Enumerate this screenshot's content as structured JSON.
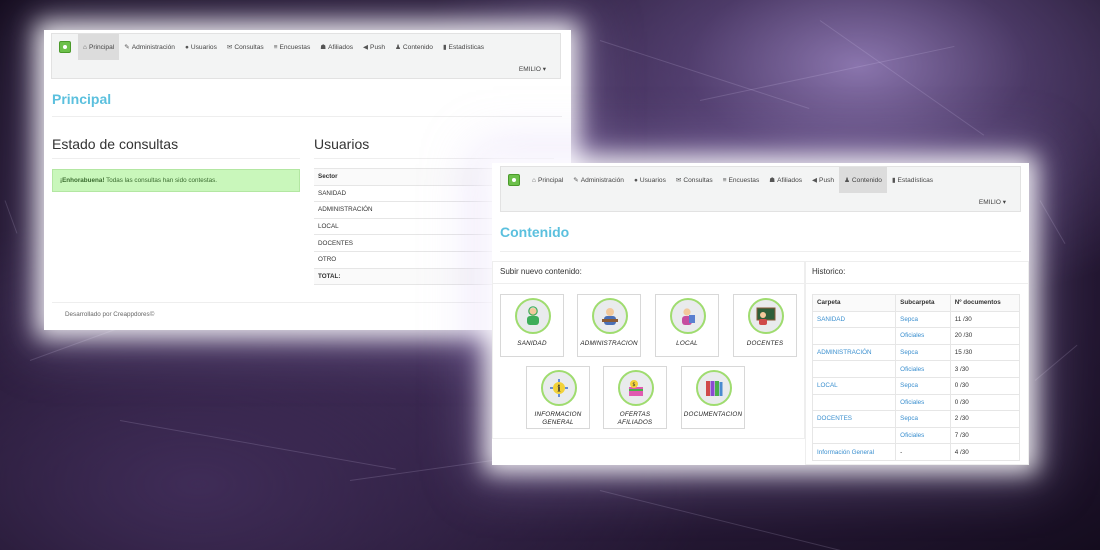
{
  "nav": {
    "items": [
      {
        "icon": "home-icon",
        "glyph": "⌂",
        "label": "Principal"
      },
      {
        "icon": "wrench-icon",
        "glyph": "✎",
        "label": "Administración"
      },
      {
        "icon": "user-icon",
        "glyph": "●",
        "label": "Usuarios"
      },
      {
        "icon": "envelope-icon",
        "glyph": "✉",
        "label": "Consultas"
      },
      {
        "icon": "list-icon",
        "glyph": "≡",
        "label": "Encuestas"
      },
      {
        "icon": "group-icon",
        "glyph": "☗",
        "label": "Afiliados"
      },
      {
        "icon": "megaphone-icon",
        "glyph": "◀",
        "label": "Push"
      },
      {
        "icon": "content-icon",
        "glyph": "♟",
        "label": "Contenido"
      },
      {
        "icon": "stats-icon",
        "glyph": "▮",
        "label": "Estadísticas"
      }
    ],
    "user": "EMILIO ▾"
  },
  "window1": {
    "active": "Principal",
    "title": "Principal",
    "consultas_heading": "Estado de consultas",
    "alert_strong": "¡Enhorabuena!",
    "alert_text": " Todas las consultas han sido contestas.",
    "usuarios_heading": "Usuarios",
    "sector_header": "Sector",
    "sectors": [
      "SANIDAD",
      "ADMINISTRACIÓN",
      "LOCAL",
      "DOCENTES",
      "OTRO"
    ],
    "total_label": "TOTAL:",
    "footer": "Desarrollado por Creappdores©"
  },
  "window2": {
    "active": "Contenido",
    "title": "Contenido",
    "upload_heading": "Subir nuevo contenido:",
    "tiles": [
      {
        "label": "SANIDAD",
        "icon": "doctor-icon"
      },
      {
        "label": "ADMINISTRACION",
        "icon": "office-worker-icon"
      },
      {
        "label": "LOCAL",
        "icon": "local-worker-icon"
      },
      {
        "label": "DOCENTES",
        "icon": "teacher-icon"
      },
      {
        "label": "INFORMACION GENERAL",
        "icon": "info-icon"
      },
      {
        "label": "OFERTAS AFILIADOS",
        "icon": "offers-icon"
      },
      {
        "label": "DOCUMENTACION",
        "icon": "binders-icon"
      }
    ],
    "history_heading": "Historico:",
    "history_headers": [
      "Carpeta",
      "Subcarpeta",
      "Nº documentos"
    ],
    "history_rows": [
      {
        "carpeta": "SANIDAD",
        "sub": "Sepca",
        "docs": "11 /30"
      },
      {
        "carpeta": "",
        "sub": "Oficiales",
        "docs": "20 /30"
      },
      {
        "carpeta": "ADMINISTRACIÓN",
        "sub": "Sepca",
        "docs": "15 /30"
      },
      {
        "carpeta": "",
        "sub": "Oficiales",
        "docs": "3 /30"
      },
      {
        "carpeta": "LOCAL",
        "sub": "Sepca",
        "docs": "0 /30"
      },
      {
        "carpeta": "",
        "sub": "Oficiales",
        "docs": "0 /30"
      },
      {
        "carpeta": "DOCENTES",
        "sub": "Sepca",
        "docs": "2 /30"
      },
      {
        "carpeta": "",
        "sub": "Oficiales",
        "docs": "7 /30"
      },
      {
        "carpeta": "Información General",
        "sub": "-",
        "docs": "4 /30"
      }
    ]
  },
  "colors": {
    "accent": "#5bc0de",
    "link": "#3a8fcf",
    "success_bg": "#c9f7bb",
    "tile_ring": "#9fdc6f"
  }
}
